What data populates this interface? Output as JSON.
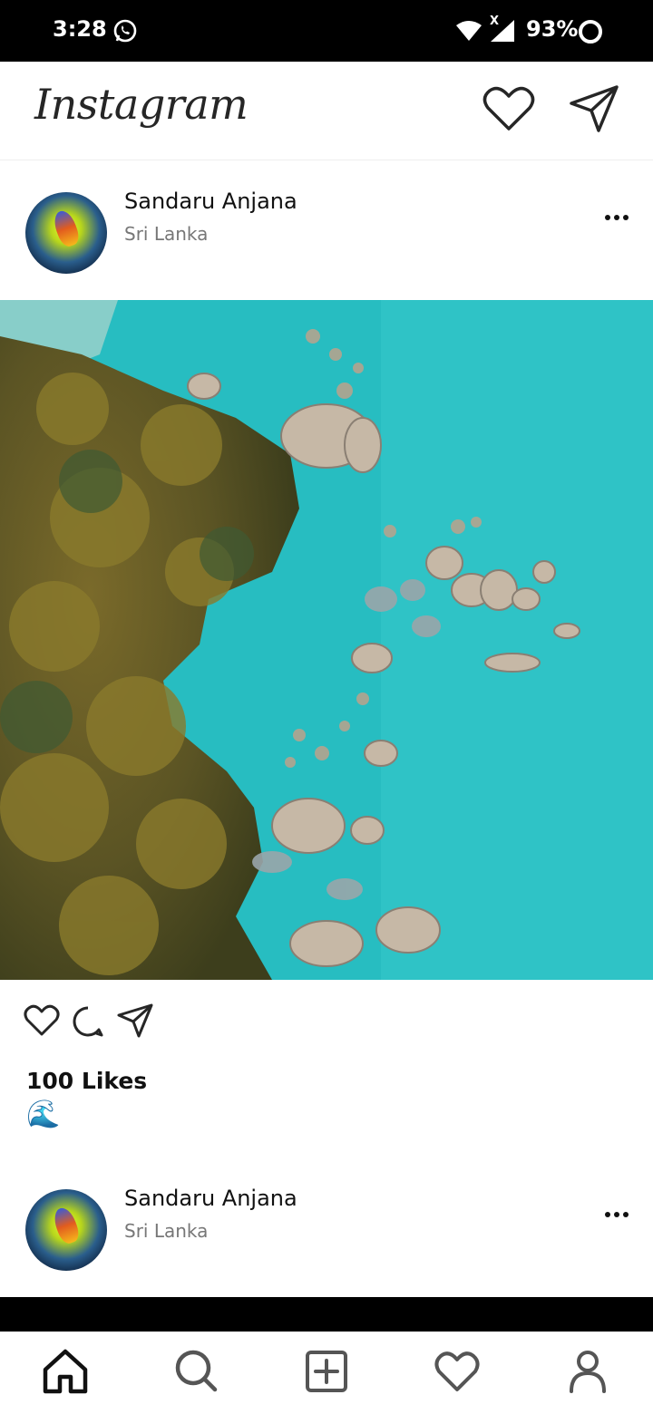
{
  "status_bar": {
    "time": "3:28",
    "battery": "93%",
    "network_badge": "X"
  },
  "app": {
    "title": "Instagram"
  },
  "posts": [
    {
      "user": "Sandaru Anjana",
      "location": "Sri Lanka",
      "likes": "100 Likes",
      "caption": "🌊"
    },
    {
      "user": "Sandaru Anjana",
      "location": "Sri Lanka"
    }
  ],
  "icons": {
    "top": [
      "heart-icon",
      "send-icon"
    ],
    "post_actions": [
      "heart-icon",
      "comment-icon",
      "share-icon"
    ],
    "bottom_nav": [
      "home-icon",
      "search-icon",
      "add-post-icon",
      "activity-heart-icon",
      "profile-icon"
    ]
  },
  "colors": {
    "status_bar": "#000000",
    "background": "#ffffff",
    "icon": "#262626",
    "sea": "#2cc3c4"
  }
}
